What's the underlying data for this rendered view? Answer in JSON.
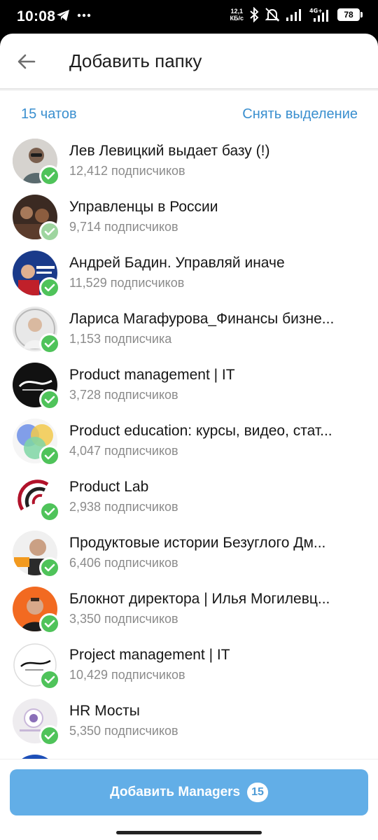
{
  "status": {
    "time": "10:08",
    "netspeed_value": "12,1",
    "netspeed_unit": "КБ/с",
    "battery": "78"
  },
  "header": {
    "title": "Добавить папку"
  },
  "selection": {
    "count_label": "15 чатов",
    "deselect_label": "Снять выделение"
  },
  "chats": [
    {
      "title": "Лев Левицкий выдает базу (!)",
      "subtitle": "12,412 подписчиков"
    },
    {
      "title": "Управленцы в России",
      "subtitle": "9,714 подписчиков"
    },
    {
      "title": "Андрей Бадин. Управляй иначе",
      "subtitle": "11,529 подписчиков"
    },
    {
      "title": "Лариса Магафурова_Финансы бизне...",
      "subtitle": "1,153 подписчика"
    },
    {
      "title": "Product management | IT",
      "subtitle": "3,728 подписчиков"
    },
    {
      "title": "Product education: курсы, видео, стат...",
      "subtitle": "4,047 подписчиков"
    },
    {
      "title": "Product Lab",
      "subtitle": "2,938 подписчиков"
    },
    {
      "title": "Продуктовые истории Безуглого Дм...",
      "subtitle": "6,406 подписчиков"
    },
    {
      "title": "Блокнот директора | Илья Могилевц...",
      "subtitle": "3,350 подписчиков"
    },
    {
      "title": "Project management | IT",
      "subtitle": "10,429 подписчиков"
    },
    {
      "title": "HR Мосты",
      "subtitle": "5,350 подписчиков"
    }
  ],
  "footer": {
    "add_label": "Добавить Managers",
    "add_count": "15"
  },
  "colors": {
    "accent": "#3a8fcf",
    "button": "#62aee7",
    "check": "#4fc35a"
  }
}
